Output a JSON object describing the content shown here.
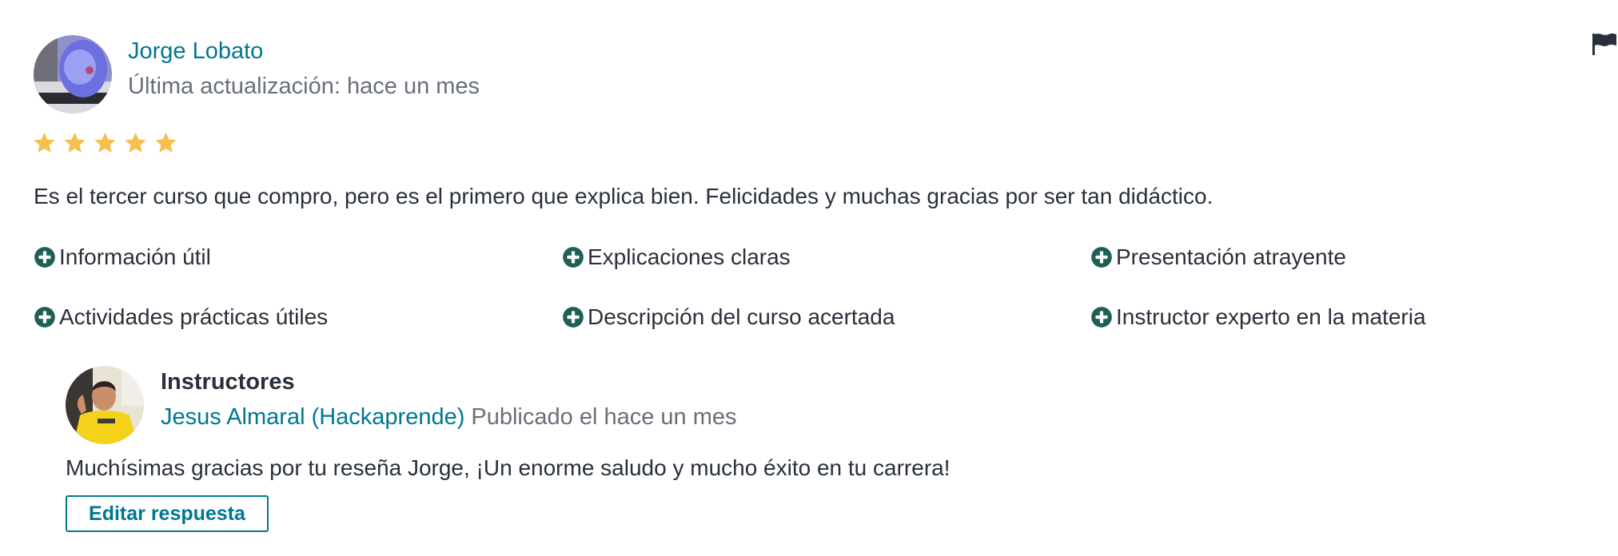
{
  "review": {
    "reviewer_name": "Jorge Lobato",
    "updated": "Última actualización: hace un mes",
    "rating": 5,
    "rating_max": 5,
    "comment": "Es el tercer curso que compro, pero es el primero que explica bien. Felicidades y muchas gracias por ser tan didáctico.",
    "tags": [
      "Información útil",
      "Explicaciones claras",
      "Presentación atrayente",
      "Actividades prácticas útiles",
      "Descripción del curso acertada",
      "Instructor experto en la materia"
    ]
  },
  "response": {
    "heading": "Instructores",
    "instructor_name": "Jesus Almaral (Hackaprende)",
    "published": "Publicado el hace un mes",
    "text": "Muchísimas gracias por tu reseña Jorge, ¡Un enorme saludo y mucho éxito en tu carrera!",
    "edit_button": "Editar respuesta"
  },
  "colors": {
    "link": "#007791",
    "muted_text": "#686f7a",
    "star": "#f4c150",
    "tag_icon": "#1e6055",
    "body_text": "#29303b"
  },
  "icons": {
    "flag": "flag-icon",
    "star": "star-icon",
    "tag": "plus-circle-icon"
  }
}
